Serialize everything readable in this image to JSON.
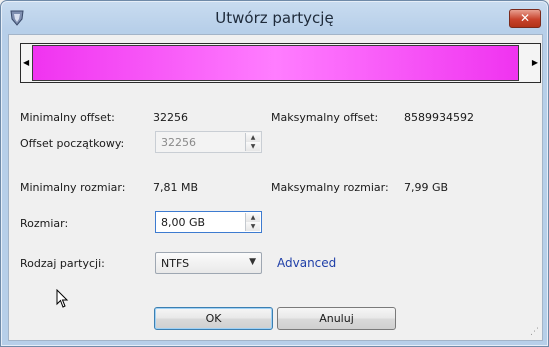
{
  "window": {
    "title": "Utwórz partycję",
    "close_glyph": "✕"
  },
  "fields": {
    "min_offset_label": "Minimalny offset:",
    "min_offset_value": "32256",
    "max_offset_label": "Maksymalny offset:",
    "max_offset_value": "8589934592",
    "start_offset_label": "Offset początkowy:",
    "start_offset_value": "32256",
    "min_size_label": "Minimalny rozmiar:",
    "min_size_value": "7,81 MB",
    "max_size_label": "Maksymalny rozmiar:",
    "max_size_value": "7,99 GB",
    "size_label": "Rozmiar:",
    "size_value": "8,00 GB",
    "type_label": "Rodzaj partycji:",
    "type_value": "NTFS",
    "advanced_link": "Advanced"
  },
  "buttons": {
    "ok": "OK",
    "cancel": "Anuluj"
  },
  "colors": {
    "partition": "#f033f0",
    "link": "#1f3fa8",
    "close": "#c8432c"
  },
  "icons": [
    "app-shield-icon",
    "close-icon",
    "spin-up-icon",
    "spin-down-icon",
    "dropdown-caret-icon",
    "mouse-cursor-icon",
    "resize-grip-icon"
  ]
}
